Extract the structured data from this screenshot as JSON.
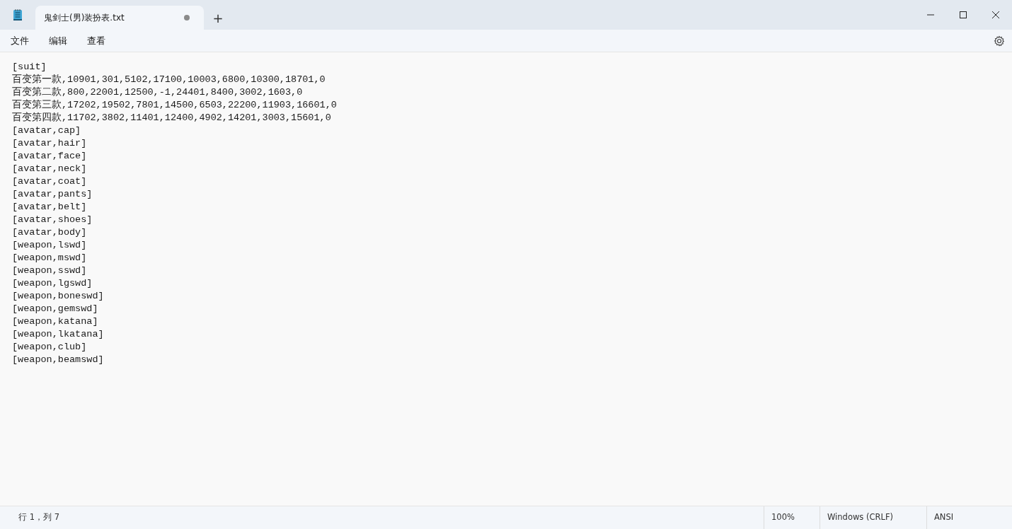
{
  "tab": {
    "title": "鬼剑士(男)装扮表.txt",
    "modified": true
  },
  "new_tab": "+",
  "menu": [
    "文件",
    "编辑",
    "查看"
  ],
  "lines": [
    "[suit]",
    "百变第一款,10901,301,5102,17100,10003,6800,10300,18701,0",
    "百变第二款,800,22001,12500,-1,24401,8400,3002,1603,0",
    "百变第三款,17202,19502,7801,14500,6503,22200,11903,16601,0",
    "百变第四款,11702,3802,11401,12400,4902,14201,3003,15601,0",
    "[avatar,cap]",
    "[avatar,hair]",
    "[avatar,face]",
    "[avatar,neck]",
    "[avatar,coat]",
    "[avatar,pants]",
    "[avatar,belt]",
    "[avatar,shoes]",
    "[avatar,body]",
    "[weapon,lswd]",
    "[weapon,mswd]",
    "[weapon,sswd]",
    "[weapon,lgswd]",
    "[weapon,boneswd]",
    "[weapon,gemswd]",
    "[weapon,katana]",
    "[weapon,lkatana]",
    "[weapon,club]",
    "[weapon,beamswd]"
  ],
  "status_bar": {
    "position": "行 1，列 7",
    "zoom": "100%",
    "line_ending": "Windows (CRLF)",
    "encoding": "ANSI"
  }
}
